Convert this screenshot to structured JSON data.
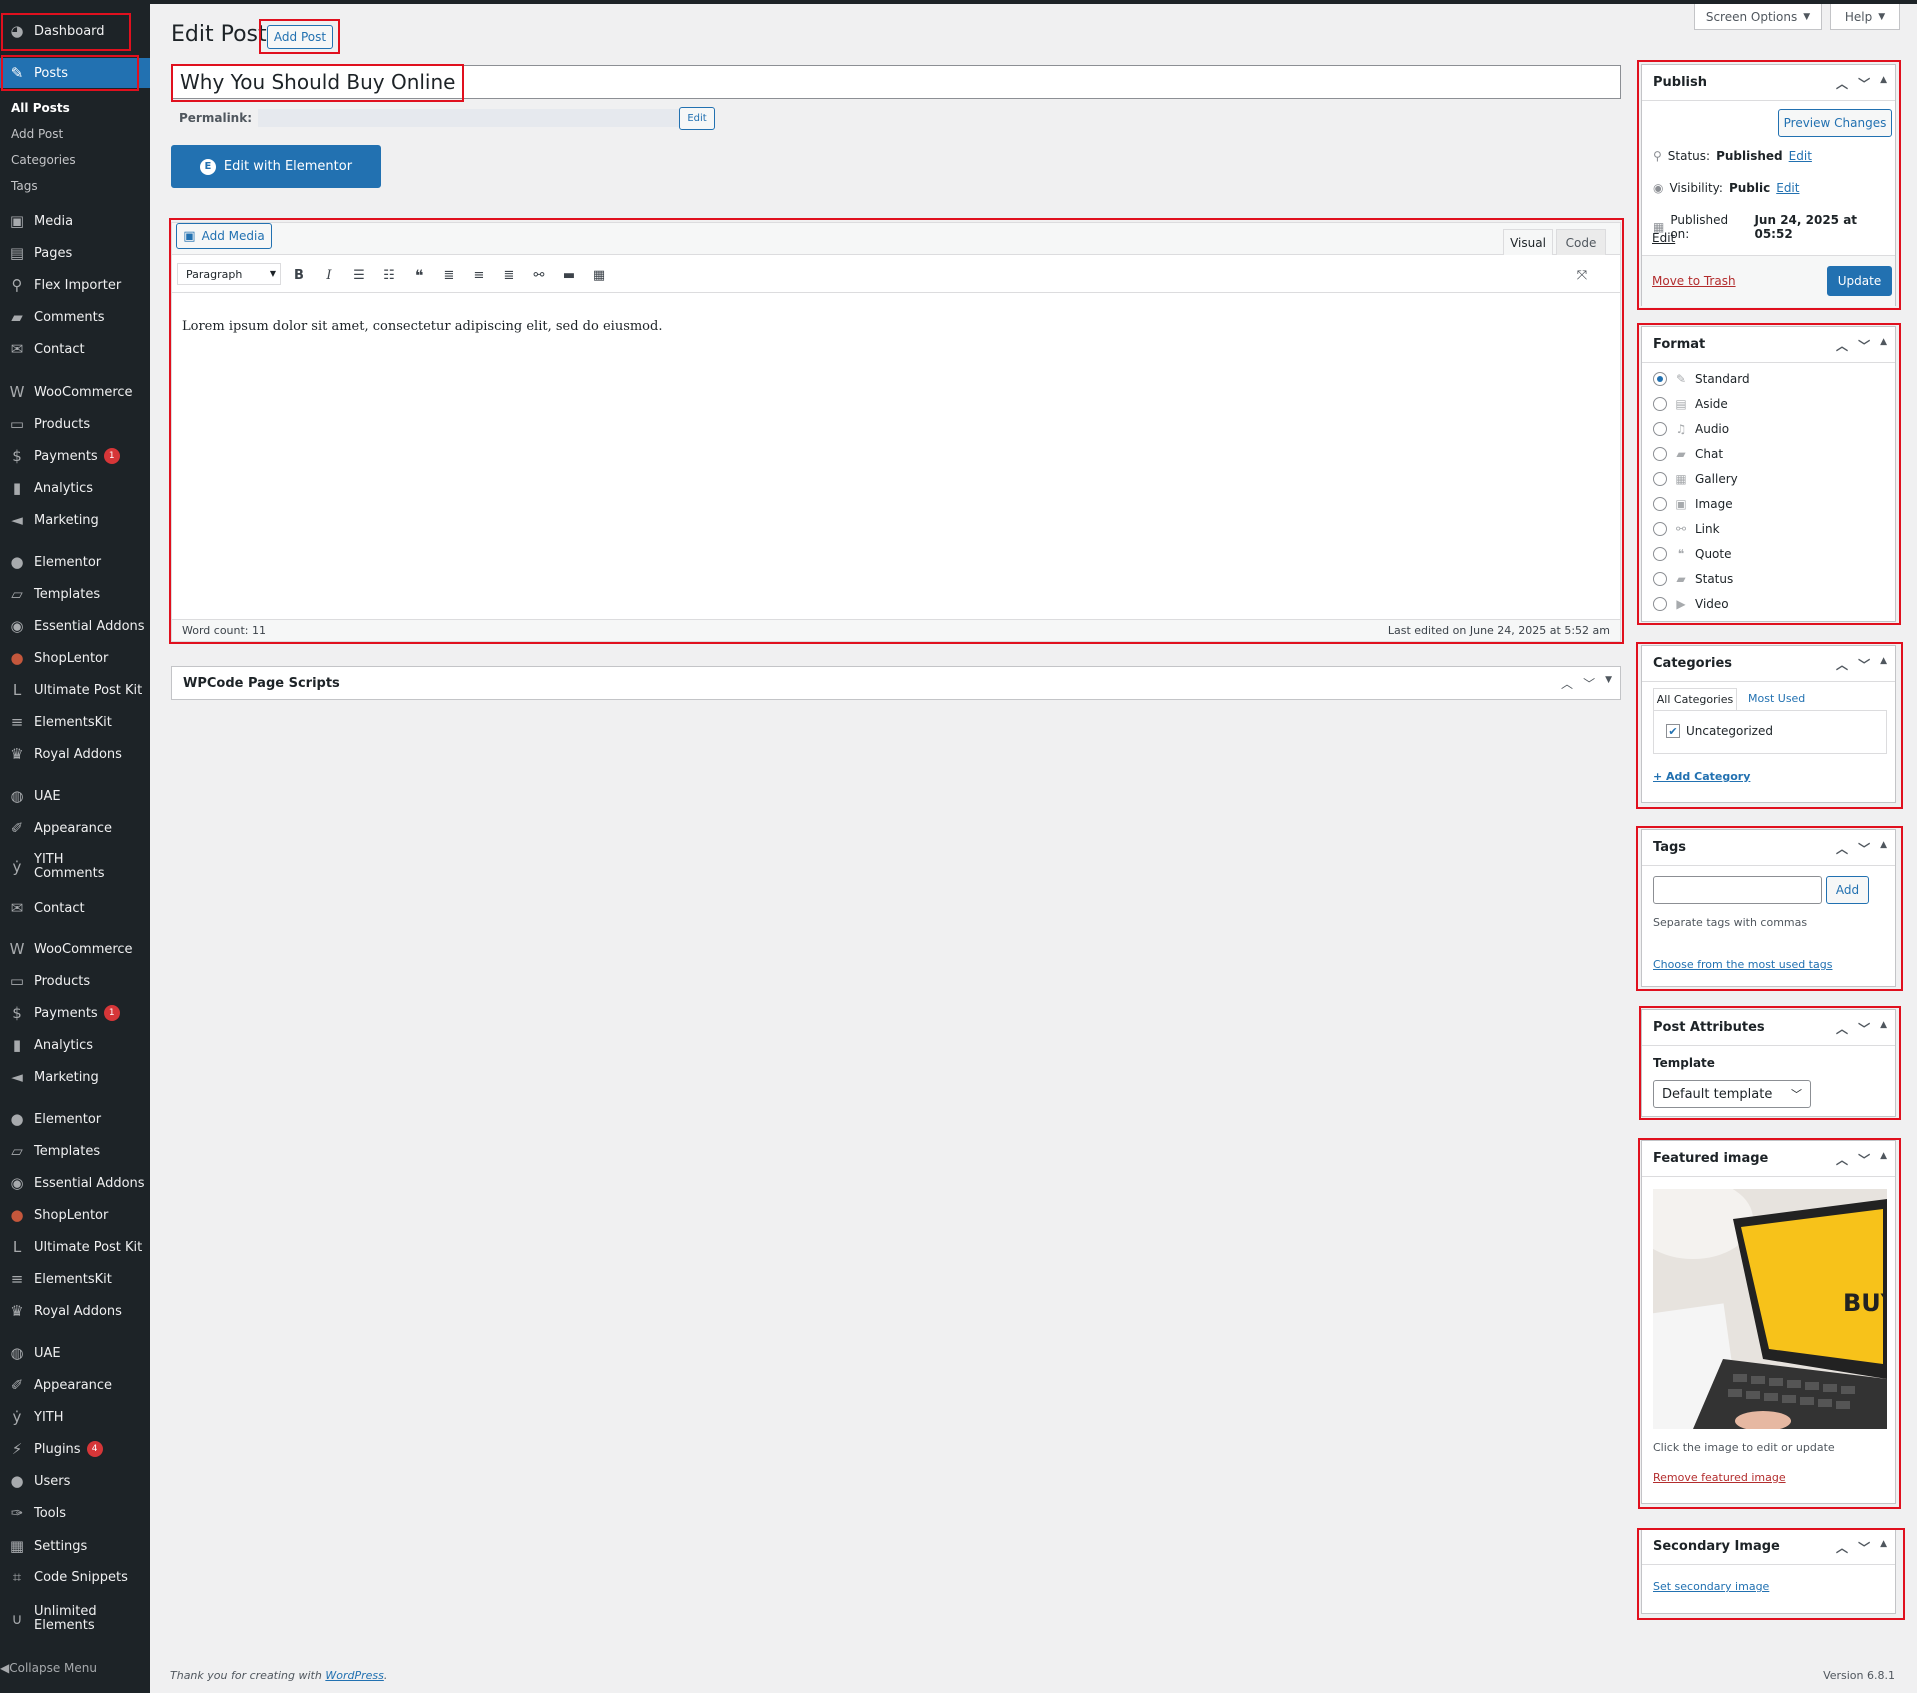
{
  "sidebar": {
    "items": [
      {
        "label": "Dashboard",
        "icon": "dashboard-icon"
      },
      {
        "label": "Posts",
        "icon": "pin-icon"
      },
      {
        "label": "Media",
        "icon": "media-icon"
      },
      {
        "label": "Pages",
        "icon": "pages-icon"
      },
      {
        "label": "Flex Importer",
        "icon": "plug-icon"
      },
      {
        "label": "Comments",
        "icon": "comment-icon"
      },
      {
        "label": "Contact",
        "icon": "mail-icon"
      },
      {
        "label": "WooCommerce",
        "icon": "woo-icon"
      },
      {
        "label": "Products",
        "icon": "archive-icon"
      },
      {
        "label": "Payments",
        "icon": "payments-icon",
        "badge": "1"
      },
      {
        "label": "Analytics",
        "icon": "chart-icon"
      },
      {
        "label": "Marketing",
        "icon": "megaphone-icon"
      },
      {
        "label": "Elementor",
        "icon": "elementor-icon"
      },
      {
        "label": "Templates",
        "icon": "folder-icon"
      },
      {
        "label": "Essential Addons",
        "icon": "ea-icon"
      },
      {
        "label": "ShopLentor",
        "icon": "shoplentor-icon"
      },
      {
        "label": "Ultimate Post Kit",
        "icon": "upk-icon"
      },
      {
        "label": "ElementsKit",
        "icon": "ek-icon"
      },
      {
        "label": "Royal Addons",
        "icon": "crown-icon"
      },
      {
        "label": "UAE",
        "icon": "uae-icon"
      },
      {
        "label": "Appearance",
        "icon": "brush-icon"
      },
      {
        "label": "YITH Comments",
        "icon": "yith-icon"
      },
      {
        "label": "Contact",
        "icon": "mail-icon"
      },
      {
        "label": "WooCommerce",
        "icon": "woo-icon"
      },
      {
        "label": "Products",
        "icon": "archive-icon"
      },
      {
        "label": "Payments",
        "icon": "payments-icon",
        "badge": "1"
      },
      {
        "label": "Analytics",
        "icon": "chart-icon"
      },
      {
        "label": "Marketing",
        "icon": "megaphone-icon"
      },
      {
        "label": "Elementor",
        "icon": "elementor-icon"
      },
      {
        "label": "Templates",
        "icon": "folder-icon"
      },
      {
        "label": "Essential Addons",
        "icon": "ea-icon"
      },
      {
        "label": "ShopLentor",
        "icon": "shoplentor-icon"
      },
      {
        "label": "Ultimate Post Kit",
        "icon": "upk-icon"
      },
      {
        "label": "ElementsKit",
        "icon": "ek-icon"
      },
      {
        "label": "Royal Addons",
        "icon": "crown-icon"
      },
      {
        "label": "UAE",
        "icon": "uae-icon"
      },
      {
        "label": "Appearance",
        "icon": "brush-icon"
      },
      {
        "label": "YITH",
        "icon": "yith-icon"
      },
      {
        "label": "Plugins",
        "icon": "plugin-icon",
        "badge": "4"
      },
      {
        "label": "Users",
        "icon": "user-icon"
      },
      {
        "label": "Tools",
        "icon": "wrench-icon"
      },
      {
        "label": "Settings",
        "icon": "settings-icon"
      },
      {
        "label": "Code Snippets",
        "icon": "code-icon"
      },
      {
        "label": "Unlimited Elements",
        "icon": "ue-icon"
      }
    ],
    "submenu": [
      "All Posts",
      "Add Post",
      "Categories",
      "Tags"
    ],
    "collapse_label": "Collapse Menu"
  },
  "header": {
    "title": "Edit Post",
    "add_post": "Add Post",
    "screen_options": "Screen Options",
    "help": "Help"
  },
  "post": {
    "title": "Why You Should Buy Online",
    "permalink_label": "Permalink:",
    "permalink_edit": "Edit",
    "elementor_button": "Edit with Elementor"
  },
  "editor": {
    "add_media": "Add Media",
    "tab_visual": "Visual",
    "tab_code": "Code",
    "format_select": "Paragraph",
    "content": "Lorem ipsum dolor sit amet, consectetur adipiscing elit, sed do eiusmod.",
    "word_count": "Word count: 11",
    "last_edited": "Last edited on June 24, 2025 at 5:52 am"
  },
  "wpcode": {
    "title": "WPCode Page Scripts"
  },
  "publish": {
    "title": "Publish",
    "preview": "Preview Changes",
    "status_label": "Status:",
    "status_value": "Published",
    "visibility_label": "Visibility:",
    "visibility_value": "Public",
    "published_label": "Published on:",
    "published_value": "Jun 24, 2025 at 05:52",
    "edit": "Edit",
    "trash": "Move to Trash",
    "update": "Update"
  },
  "format": {
    "title": "Format",
    "options": [
      "Standard",
      "Aside",
      "Audio",
      "Chat",
      "Gallery",
      "Image",
      "Link",
      "Quote",
      "Status",
      "Video"
    ],
    "selected": "Standard"
  },
  "categories": {
    "title": "Categories",
    "tab_all": "All Categories",
    "tab_most": "Most Used",
    "items": [
      "Uncategorized"
    ],
    "add": "+ Add Category"
  },
  "tags": {
    "title": "Tags",
    "add": "Add",
    "hint": "Separate tags with commas",
    "choose": "Choose from the most used tags"
  },
  "attributes": {
    "title": "Post Attributes",
    "template_label": "Template",
    "template_value": "Default template"
  },
  "featured": {
    "title": "Featured image",
    "image_text": "BUY",
    "hint": "Click the image to edit or update",
    "remove": "Remove featured image"
  },
  "secondary": {
    "title": "Secondary Image",
    "set": "Set secondary image"
  },
  "footer": {
    "thanks": "Thank you for creating with",
    "wp_link": "WordPress",
    "period": ".",
    "version": "Version 6.8.1"
  },
  "colors": {
    "accent": "#2271b1",
    "sidebar_bg": "#1d2327",
    "highlight": "#e0101e",
    "badge": "#d63638",
    "danger": "#b32d2e"
  }
}
